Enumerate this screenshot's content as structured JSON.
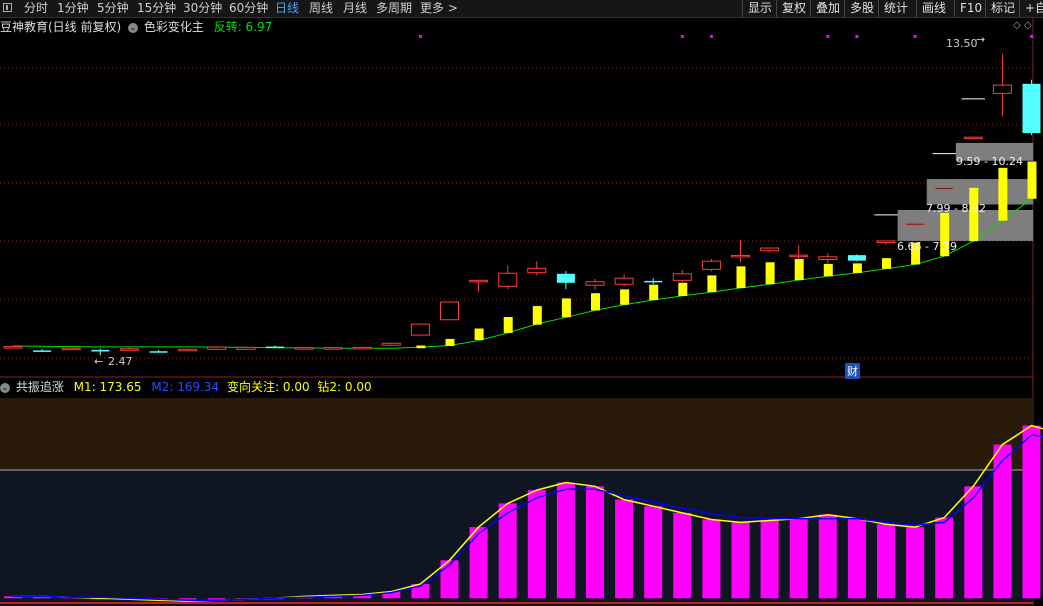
{
  "toolbar": {
    "periods": [
      "分时",
      "1分钟",
      "5分钟",
      "15分钟",
      "30分钟",
      "60分钟",
      "日线",
      "周线",
      "月线",
      "多周期",
      "更多 >"
    ],
    "active_period": "日线",
    "right_buttons": [
      "显示",
      "复权",
      "叠加",
      "多股",
      "统计",
      "画线",
      "F10",
      "标记",
      "+自"
    ]
  },
  "main_header": {
    "title": "豆神教育(日线 前复权)",
    "indicator_toggle": "⌄",
    "indicator_name": "色彩变化主",
    "metric_label": "反转: 6.97"
  },
  "annotations": {
    "high_price": "13.50",
    "low_price": "2.47",
    "finance_badge": "财",
    "zones": [
      "9.59 - 10.24",
      "7.99 - 8.92",
      "6.66 - 7.79"
    ]
  },
  "sub_header": {
    "toggle": "⌄",
    "indicator_name": "共振追涨",
    "m1": "M1: 173.65",
    "m2": "M2: 169.34",
    "turn": "变向关注: 0.00",
    "drill": "钻2: 0.00"
  },
  "colors": {
    "up": "#ff3c3c",
    "down": "#54ffff",
    "signal_bar": "#ffff00",
    "ma_line": "#00e000",
    "bar": "#ff00ff",
    "m1_line": "#ffff00",
    "m2_line": "#0000ff",
    "grid": "#8a2020",
    "zone": "#8c8c8c",
    "dot": "#ff00ff"
  },
  "chart_data": [
    {
      "type": "candlestick",
      "candles": [
        {
          "open": 2.78,
          "high": 2.83,
          "low": 2.76,
          "close": 2.8
        },
        {
          "open": 2.66,
          "high": 2.71,
          "low": 2.61,
          "close": 2.63
        },
        {
          "open": 2.71,
          "high": 2.76,
          "low": 2.68,
          "close": 2.74
        },
        {
          "open": 2.68,
          "high": 2.73,
          "low": 2.47,
          "close": 2.62
        },
        {
          "open": 2.7,
          "high": 2.77,
          "low": 2.67,
          "close": 2.72
        },
        {
          "open": 2.63,
          "high": 2.68,
          "low": 2.58,
          "close": 2.6
        },
        {
          "open": 2.68,
          "high": 2.73,
          "low": 2.65,
          "close": 2.7
        },
        {
          "open": 2.7,
          "high": 2.81,
          "low": 2.67,
          "close": 2.78
        },
        {
          "open": 2.7,
          "high": 2.8,
          "low": 2.67,
          "close": 2.77
        },
        {
          "open": 2.8,
          "high": 2.84,
          "low": 2.75,
          "close": 2.76
        },
        {
          "open": 2.74,
          "high": 2.79,
          "low": 2.7,
          "close": 2.76
        },
        {
          "open": 2.72,
          "high": 2.79,
          "low": 2.69,
          "close": 2.76
        },
        {
          "open": 2.74,
          "high": 2.79,
          "low": 2.71,
          "close": 2.77
        },
        {
          "open": 2.85,
          "high": 2.95,
          "low": 2.82,
          "close": 2.92
        },
        {
          "open": 3.22,
          "high": 3.65,
          "low": 3.22,
          "close": 3.62
        },
        {
          "open": 3.78,
          "high": 4.45,
          "low": 3.78,
          "close": 4.43
        },
        {
          "open": 5.2,
          "high": 5.2,
          "low": 4.8,
          "close": 5.22
        },
        {
          "open": 5.0,
          "high": 5.76,
          "low": 4.9,
          "close": 5.48
        },
        {
          "open": 5.5,
          "high": 5.92,
          "low": 5.4,
          "close": 5.66
        },
        {
          "open": 5.46,
          "high": 5.56,
          "low": 4.9,
          "close": 5.13
        },
        {
          "open": 5.04,
          "high": 5.28,
          "low": 4.88,
          "close": 5.17
        },
        {
          "open": 5.08,
          "high": 5.45,
          "low": 5.0,
          "close": 5.3
        },
        {
          "open": 5.2,
          "high": 5.3,
          "low": 5.08,
          "close": 5.16
        },
        {
          "open": 5.22,
          "high": 5.6,
          "low": 5.15,
          "close": 5.46
        },
        {
          "open": 5.62,
          "high": 6.0,
          "low": 5.55,
          "close": 5.92
        },
        {
          "open": 6.13,
          "high": 6.69,
          "low": 5.87,
          "close": 6.13
        },
        {
          "open": 6.3,
          "high": 6.42,
          "low": 6.24,
          "close": 6.4
        },
        {
          "open": 6.14,
          "high": 6.49,
          "low": 5.98,
          "close": 6.14
        },
        {
          "open": 5.98,
          "high": 6.21,
          "low": 5.84,
          "close": 6.08
        },
        {
          "open": 6.14,
          "high": 6.17,
          "low": 5.91,
          "close": 5.94
        },
        {
          "open": 6.6,
          "high": 6.66,
          "low": 6.53,
          "close": 6.66
        },
        {
          "open": 7.3,
          "high": 7.3,
          "low": 7.3,
          "close": 7.3
        },
        {
          "open": 8.6,
          "high": 8.6,
          "low": 8.6,
          "close": 8.6
        },
        {
          "open": 10.45,
          "high": 10.45,
          "low": 10.45,
          "close": 10.45
        },
        {
          "open": 12.05,
          "high": 13.5,
          "low": 11.22,
          "close": 12.35
        },
        {
          "open": 12.4,
          "high": 12.55,
          "low": 10.52,
          "close": 10.6
        }
      ],
      "signal_bars": [
        {
          "idx": 14,
          "top": 2.84,
          "bottom": 2.74
        },
        {
          "idx": 15,
          "top": 3.08,
          "bottom": 2.82
        },
        {
          "idx": 16,
          "top": 3.46,
          "bottom": 3.04
        },
        {
          "idx": 17,
          "top": 3.88,
          "bottom": 3.3
        },
        {
          "idx": 18,
          "top": 4.28,
          "bottom": 3.6
        },
        {
          "idx": 19,
          "top": 4.56,
          "bottom": 3.87
        },
        {
          "idx": 20,
          "top": 4.75,
          "bottom": 4.12
        },
        {
          "idx": 21,
          "top": 4.89,
          "bottom": 4.33
        },
        {
          "idx": 22,
          "top": 5.06,
          "bottom": 4.5
        },
        {
          "idx": 23,
          "top": 5.13,
          "bottom": 4.65
        },
        {
          "idx": 24,
          "top": 5.4,
          "bottom": 4.79
        },
        {
          "idx": 25,
          "top": 5.73,
          "bottom": 4.94
        },
        {
          "idx": 26,
          "top": 5.88,
          "bottom": 5.08
        },
        {
          "idx": 27,
          "top": 6.0,
          "bottom": 5.23
        },
        {
          "idx": 28,
          "top": 5.82,
          "bottom": 5.37
        },
        {
          "idx": 29,
          "top": 5.84,
          "bottom": 5.49
        },
        {
          "idx": 30,
          "top": 6.03,
          "bottom": 5.64
        },
        {
          "idx": 31,
          "top": 6.6,
          "bottom": 5.8
        },
        {
          "idx": 32,
          "top": 7.68,
          "bottom": 6.1
        },
        {
          "idx": 33,
          "top": 8.6,
          "bottom": 6.65
        },
        {
          "idx": 34,
          "top": 9.33,
          "bottom": 7.4
        },
        {
          "idx": 35,
          "top": 9.56,
          "bottom": 8.2
        }
      ],
      "ma": [
        2.82,
        2.81,
        2.8,
        2.79,
        2.79,
        2.79,
        2.79,
        2.78,
        2.77,
        2.76,
        2.75,
        2.74,
        2.74,
        2.74,
        2.78,
        2.84,
        3.02,
        3.3,
        3.62,
        3.87,
        4.12,
        4.33,
        4.5,
        4.65,
        4.79,
        4.94,
        5.08,
        5.23,
        5.37,
        5.49,
        5.64,
        5.8,
        6.1,
        6.65,
        7.4,
        8.2
      ],
      "zones": [
        {
          "label": "9.59 - 10.24",
          "low": 9.59,
          "high": 10.24,
          "from_idx": 32.4
        },
        {
          "label": "7.99 - 8.92",
          "low": 7.99,
          "high": 8.92,
          "from_idx": 31.4
        },
        {
          "label": "6.66 - 7.79",
          "low": 6.66,
          "high": 7.79,
          "from_idx": 30.4
        }
      ],
      "horizontal_marks": [
        {
          "y": 9.85,
          "label": "",
          "from_idx": 31.6,
          "to_idx": 32.4
        },
        {
          "y": 7.61,
          "label": "",
          "from_idx": 29.6,
          "to_idx": 30.4
        },
        {
          "y": 11.85,
          "label": "",
          "from_idx": 32.6,
          "to_idx": 33.4
        }
      ],
      "signal_dots": [
        14,
        23,
        24,
        28,
        29,
        31,
        35
      ],
      "y_range": [
        2.2,
        14.0
      ]
    },
    {
      "type": "bar+line",
      "series": [
        {
          "name": "M1",
          "values": [
            2,
            2,
            1,
            0,
            -1,
            -2,
            -3,
            -2,
            -1,
            0,
            2,
            3,
            4,
            7,
            15,
            40,
            75,
            100,
            114,
            122,
            118,
            104,
            97,
            90,
            83,
            80,
            82,
            84,
            88,
            84,
            78,
            75,
            85,
            118,
            162,
            182,
            173.65
          ]
        },
        {
          "name": "M2",
          "values": [
            2,
            2,
            1,
            1,
            0,
            -1,
            -2,
            -2,
            -1,
            0,
            1,
            2,
            3,
            6,
            13,
            35,
            68,
            90,
            106,
            115,
            115,
            108,
            101,
            95,
            89,
            85,
            84,
            84,
            84,
            84,
            80,
            77,
            80,
            106,
            145,
            172,
            169.34
          ]
        }
      ],
      "bars": [
        2,
        2,
        1,
        0,
        -1,
        -2,
        -3,
        -2,
        -1,
        0,
        2,
        3,
        4,
        7,
        15,
        40,
        75,
        100,
        114,
        122,
        118,
        104,
        97,
        90,
        83,
        80,
        82,
        84,
        88,
        84,
        78,
        75,
        85,
        118,
        162,
        182,
        173.65
      ],
      "y_range": [
        -5,
        190
      ]
    }
  ]
}
